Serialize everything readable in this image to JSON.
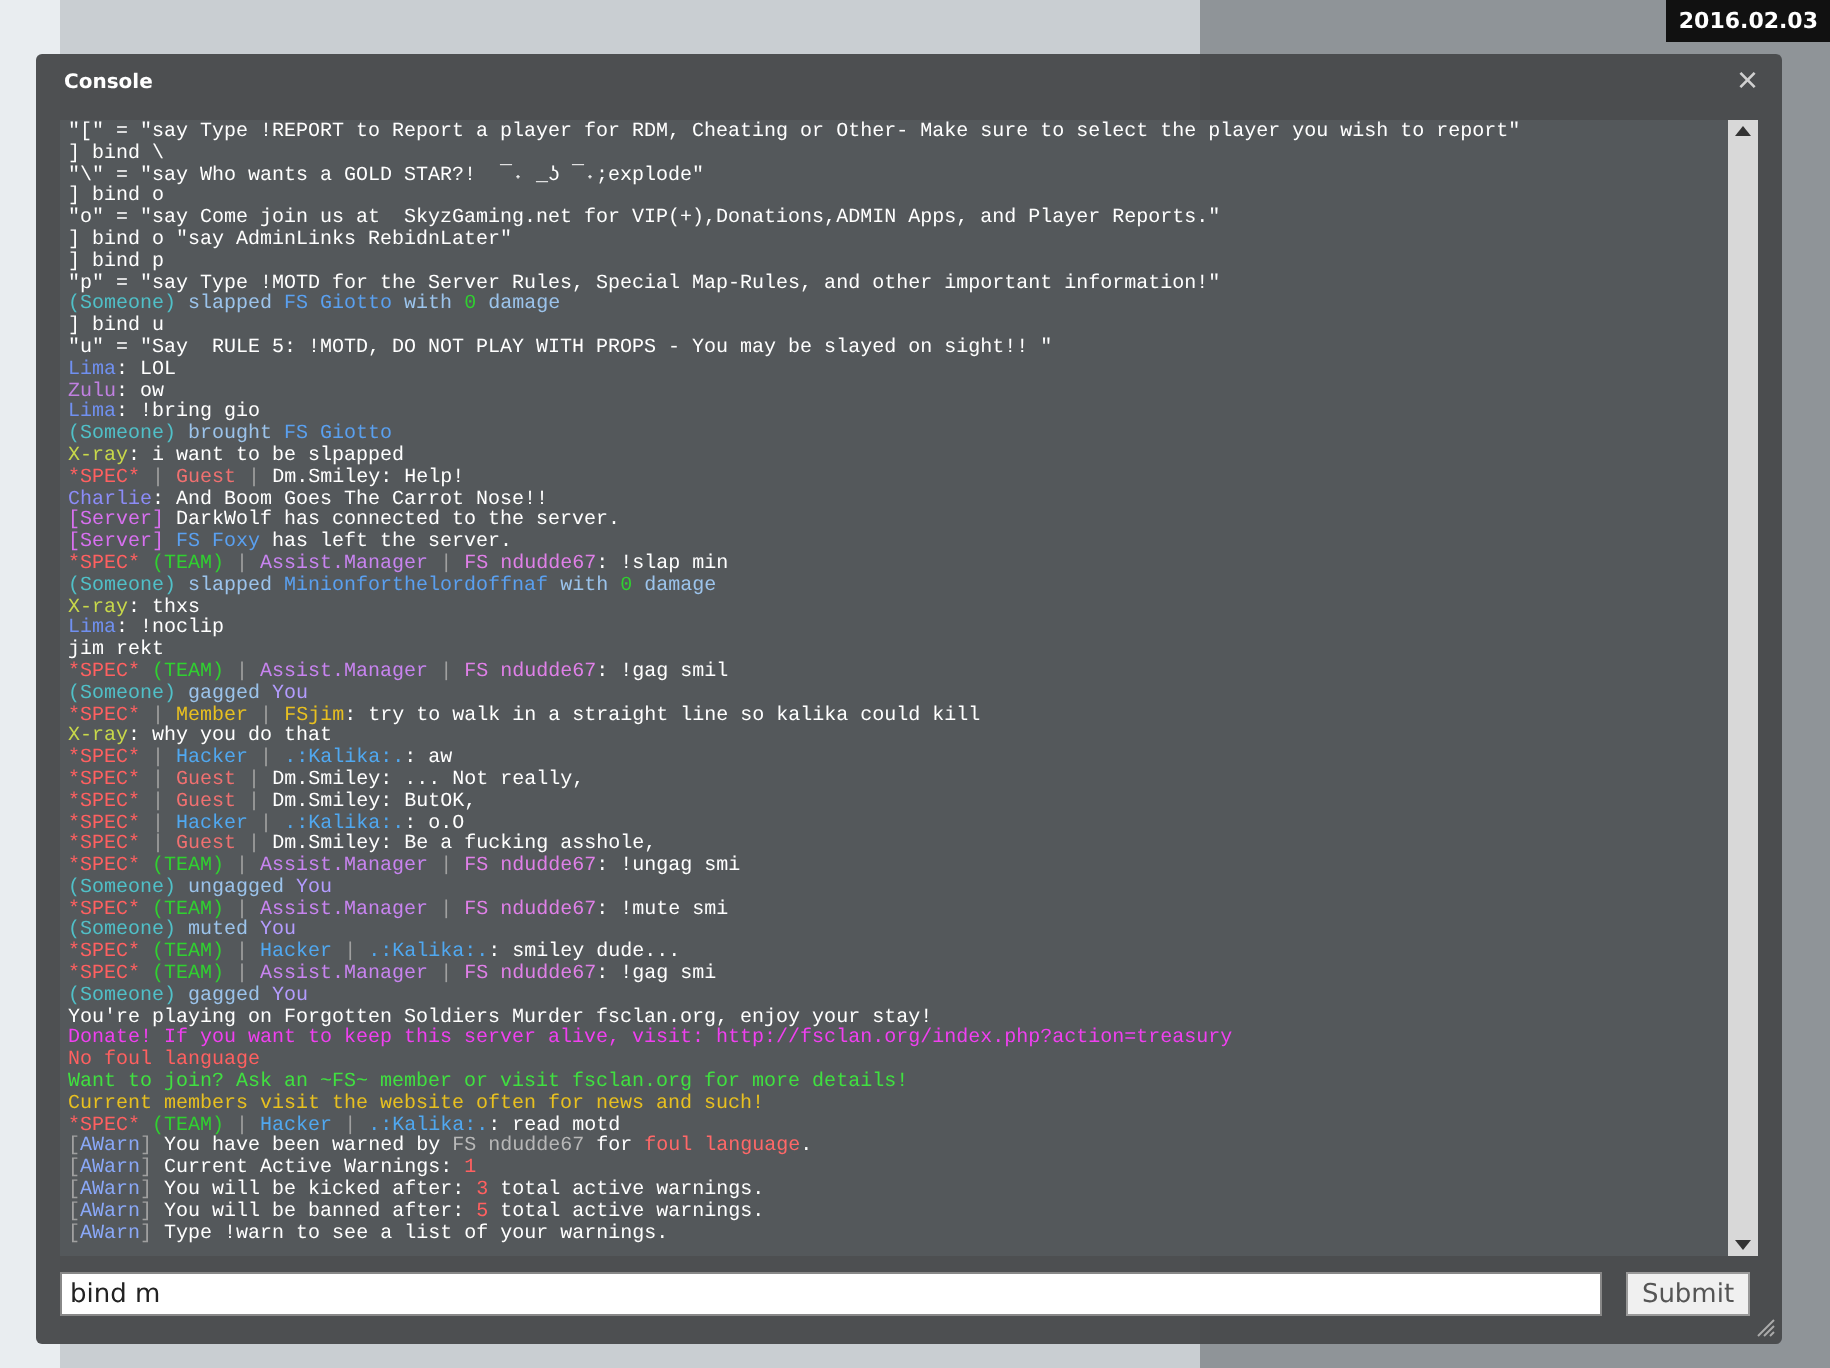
{
  "timestamp": "2016.02.03",
  "window": {
    "title": "Console",
    "close": "×"
  },
  "console": {
    "lines": [
      [
        {
          "text": "\"[\" = \"say Type !REPORT to Report a player for RDM, Cheating or Other- Make sure to select the player you wish to report\"",
          "color": "#ffffff"
        }
      ],
      [
        {
          "text": "] bind \\",
          "color": "#ffffff"
        }
      ],
      [
        {
          "text": "\"\\\" = \"say Who wants a GOLD STAR?!  ¯˖ _ʖ ¯˖;explode\"",
          "color": "#ffffff"
        }
      ],
      [
        {
          "text": "] bind o",
          "color": "#ffffff"
        }
      ],
      [
        {
          "text": "\"o\" = \"say Come join us at  SkyzGaming.net for VIP(+),Donations,ADMIN Apps, and Player Reports.\"",
          "color": "#ffffff"
        }
      ],
      [
        {
          "text": "] bind o \"say AdminLinks RebidnLater\"",
          "color": "#ffffff"
        }
      ],
      [
        {
          "text": "] bind p",
          "color": "#ffffff"
        }
      ],
      [
        {
          "text": "\"p\" = \"say Type !MOTD for the Server Rules, Special Map-Rules, and other important information!\"",
          "color": "#ffffff"
        }
      ],
      [
        {
          "text": "(Someone)",
          "color": "#50c0c8"
        },
        {
          "text": " slapped ",
          "color": "#9cc4ec"
        },
        {
          "text": "FS Giotto",
          "color": "#5aa0f0"
        },
        {
          "text": " with ",
          "color": "#9cc4ec"
        },
        {
          "text": "0",
          "color": "#30d030"
        },
        {
          "text": " damage",
          "color": "#9cc4ec"
        }
      ],
      [
        {
          "text": "] bind u",
          "color": "#ffffff"
        }
      ],
      [
        {
          "text": "\"u\" = \"Say  RULE 5: !MOTD, DO NOT PLAY WITH PROPS - You may be slayed on sight!! \"",
          "color": "#ffffff"
        }
      ],
      [
        {
          "text": "Lima",
          "color": "#7090f0"
        },
        {
          "text": ": LOL",
          "color": "#ffffff"
        }
      ],
      [
        {
          "text": "Zulu",
          "color": "#c080e0"
        },
        {
          "text": ": ow",
          "color": "#ffffff"
        }
      ],
      [
        {
          "text": "Lima",
          "color": "#7090f0"
        },
        {
          "text": ": !bring gio",
          "color": "#ffffff"
        }
      ],
      [
        {
          "text": "(Someone)",
          "color": "#50c0c8"
        },
        {
          "text": " brought ",
          "color": "#9cc4ec"
        },
        {
          "text": "FS Giotto",
          "color": "#5aa0f0"
        }
      ],
      [
        {
          "text": "X-ray",
          "color": "#c8d84a"
        },
        {
          "text": ": i want to be slpapped",
          "color": "#ffffff"
        }
      ],
      [
        {
          "text": "*SPEC*",
          "color": "#ff6060"
        },
        {
          "text": " | ",
          "color": "#a0a0a0"
        },
        {
          "text": "Guest",
          "color": "#f07070"
        },
        {
          "text": " | ",
          "color": "#a0a0a0"
        },
        {
          "text": "Dm.Smiley",
          "color": "#ffffff"
        },
        {
          "text": ": Help!",
          "color": "#ffffff"
        }
      ],
      [
        {
          "text": "Charlie",
          "color": "#8c8cf8"
        },
        {
          "text": ": And Boom Goes The Carrot Nose!!",
          "color": "#ffffff"
        }
      ],
      [
        {
          "text": "[Server]",
          "color": "#d870f0"
        },
        {
          "text": " DarkWolf has connected to the server.",
          "color": "#ffffff"
        }
      ],
      [
        {
          "text": "[Server]",
          "color": "#d870f0"
        },
        {
          "text": " FS Foxy",
          "color": "#5aa0f0"
        },
        {
          "text": " has left the server.",
          "color": "#ffffff"
        }
      ],
      [
        {
          "text": "*SPEC*",
          "color": "#ff6060"
        },
        {
          "text": " (TEAM)",
          "color": "#30d030"
        },
        {
          "text": " | ",
          "color": "#a0a0a0"
        },
        {
          "text": "Assist.Manager",
          "color": "#c884f0"
        },
        {
          "text": " | ",
          "color": "#a0a0a0"
        },
        {
          "text": "FS ndudde67",
          "color": "#e080e8"
        },
        {
          "text": ": !slap min",
          "color": "#ffffff"
        }
      ],
      [
        {
          "text": "(Someone)",
          "color": "#50c0c8"
        },
        {
          "text": " slapped ",
          "color": "#9cc4ec"
        },
        {
          "text": "Minionforthelordoffnaf",
          "color": "#5aa0f0"
        },
        {
          "text": " with ",
          "color": "#9cc4ec"
        },
        {
          "text": "0",
          "color": "#30d030"
        },
        {
          "text": " damage",
          "color": "#9cc4ec"
        }
      ],
      [
        {
          "text": "X-ray",
          "color": "#c8d84a"
        },
        {
          "text": ": thxs",
          "color": "#ffffff"
        }
      ],
      [
        {
          "text": "Lima",
          "color": "#7090f0"
        },
        {
          "text": ": !noclip",
          "color": "#ffffff"
        }
      ],
      [
        {
          "text": "jim rekt",
          "color": "#ffffff"
        }
      ],
      [
        {
          "text": "*SPEC*",
          "color": "#ff6060"
        },
        {
          "text": " (TEAM)",
          "color": "#30d030"
        },
        {
          "text": " | ",
          "color": "#a0a0a0"
        },
        {
          "text": "Assist.Manager",
          "color": "#c884f0"
        },
        {
          "text": " | ",
          "color": "#a0a0a0"
        },
        {
          "text": "FS ndudde67",
          "color": "#e080e8"
        },
        {
          "text": ": !gag smil",
          "color": "#ffffff"
        }
      ],
      [
        {
          "text": "(Someone)",
          "color": "#50c0c8"
        },
        {
          "text": " gagged ",
          "color": "#9cc4ec"
        },
        {
          "text": "You",
          "color": "#b49cff"
        }
      ],
      [
        {
          "text": "*SPEC*",
          "color": "#ff6060"
        },
        {
          "text": " | ",
          "color": "#a0a0a0"
        },
        {
          "text": "Member",
          "color": "#e8c020"
        },
        {
          "text": " | ",
          "color": "#a0a0a0"
        },
        {
          "text": "FSjim",
          "color": "#e8c020"
        },
        {
          "text": ": try to walk in a straight line so kalika could kill",
          "color": "#ffffff"
        }
      ],
      [
        {
          "text": "X-ray",
          "color": "#c8d84a"
        },
        {
          "text": ": why you do that",
          "color": "#ffffff"
        }
      ],
      [
        {
          "text": "*SPEC*",
          "color": "#ff6060"
        },
        {
          "text": " | ",
          "color": "#a0a0a0"
        },
        {
          "text": "Hacker",
          "color": "#50a8f0"
        },
        {
          "text": " | ",
          "color": "#a0a0a0"
        },
        {
          "text": ".:Kalika:.",
          "color": "#50a8f0"
        },
        {
          "text": ": aw",
          "color": "#ffffff"
        }
      ],
      [
        {
          "text": "*SPEC*",
          "color": "#ff6060"
        },
        {
          "text": " | ",
          "color": "#a0a0a0"
        },
        {
          "text": "Guest",
          "color": "#f07070"
        },
        {
          "text": " | ",
          "color": "#a0a0a0"
        },
        {
          "text": "Dm.Smiley",
          "color": "#ffffff"
        },
        {
          "text": ": ... Not really,",
          "color": "#ffffff"
        }
      ],
      [
        {
          "text": "*SPEC*",
          "color": "#ff6060"
        },
        {
          "text": " | ",
          "color": "#a0a0a0"
        },
        {
          "text": "Guest",
          "color": "#f07070"
        },
        {
          "text": " | ",
          "color": "#a0a0a0"
        },
        {
          "text": "Dm.Smiley",
          "color": "#ffffff"
        },
        {
          "text": ": ButOK,",
          "color": "#ffffff"
        }
      ],
      [
        {
          "text": "*SPEC*",
          "color": "#ff6060"
        },
        {
          "text": " | ",
          "color": "#a0a0a0"
        },
        {
          "text": "Hacker",
          "color": "#50a8f0"
        },
        {
          "text": " | ",
          "color": "#a0a0a0"
        },
        {
          "text": ".:Kalika:.",
          "color": "#50a8f0"
        },
        {
          "text": ": o.O",
          "color": "#ffffff"
        }
      ],
      [
        {
          "text": "*SPEC*",
          "color": "#ff6060"
        },
        {
          "text": " | ",
          "color": "#a0a0a0"
        },
        {
          "text": "Guest",
          "color": "#f07070"
        },
        {
          "text": " | ",
          "color": "#a0a0a0"
        },
        {
          "text": "Dm.Smiley",
          "color": "#ffffff"
        },
        {
          "text": ": Be a fucking asshole,",
          "color": "#ffffff"
        }
      ],
      [
        {
          "text": "*SPEC*",
          "color": "#ff6060"
        },
        {
          "text": " (TEAM)",
          "color": "#30d030"
        },
        {
          "text": " | ",
          "color": "#a0a0a0"
        },
        {
          "text": "Assist.Manager",
          "color": "#c884f0"
        },
        {
          "text": " | ",
          "color": "#a0a0a0"
        },
        {
          "text": "FS ndudde67",
          "color": "#e080e8"
        },
        {
          "text": ": !ungag smi",
          "color": "#ffffff"
        }
      ],
      [
        {
          "text": "(Someone)",
          "color": "#50c0c8"
        },
        {
          "text": " ungagged ",
          "color": "#9cc4ec"
        },
        {
          "text": "You",
          "color": "#b49cff"
        }
      ],
      [
        {
          "text": "*SPEC*",
          "color": "#ff6060"
        },
        {
          "text": " (TEAM)",
          "color": "#30d030"
        },
        {
          "text": " | ",
          "color": "#a0a0a0"
        },
        {
          "text": "Assist.Manager",
          "color": "#c884f0"
        },
        {
          "text": " | ",
          "color": "#a0a0a0"
        },
        {
          "text": "FS ndudde67",
          "color": "#e080e8"
        },
        {
          "text": ": !mute smi",
          "color": "#ffffff"
        }
      ],
      [
        {
          "text": "(Someone)",
          "color": "#50c0c8"
        },
        {
          "text": " muted ",
          "color": "#9cc4ec"
        },
        {
          "text": "You",
          "color": "#b49cff"
        }
      ],
      [
        {
          "text": "*SPEC*",
          "color": "#ff6060"
        },
        {
          "text": " (TEAM)",
          "color": "#30d030"
        },
        {
          "text": " | ",
          "color": "#a0a0a0"
        },
        {
          "text": "Hacker",
          "color": "#50a8f0"
        },
        {
          "text": " | ",
          "color": "#a0a0a0"
        },
        {
          "text": ".:Kalika:.",
          "color": "#50a8f0"
        },
        {
          "text": ": smiley dude...",
          "color": "#ffffff"
        }
      ],
      [
        {
          "text": "*SPEC*",
          "color": "#ff6060"
        },
        {
          "text": " (TEAM)",
          "color": "#30d030"
        },
        {
          "text": " | ",
          "color": "#a0a0a0"
        },
        {
          "text": "Assist.Manager",
          "color": "#c884f0"
        },
        {
          "text": " | ",
          "color": "#a0a0a0"
        },
        {
          "text": "FS ndudde67",
          "color": "#e080e8"
        },
        {
          "text": ": !gag smi",
          "color": "#ffffff"
        }
      ],
      [
        {
          "text": "(Someone)",
          "color": "#50c0c8"
        },
        {
          "text": " gagged ",
          "color": "#9cc4ec"
        },
        {
          "text": "You",
          "color": "#b49cff"
        }
      ],
      [
        {
          "text": "You're playing on Forgotten Soldiers Murder fsclan.org, enjoy your stay!",
          "color": "#ffffff"
        }
      ],
      [
        {
          "text": "Donate! If you want to keep this server alive, visit: http://fsclan.org/index.php?action=treasury",
          "color": "#f040f0"
        }
      ],
      [
        {
          "text": "No foul language",
          "color": "#ff6060"
        }
      ],
      [
        {
          "text": "Want to join? Ask an ~FS~ member or visit fsclan.org for more details!",
          "color": "#40e040"
        }
      ],
      [
        {
          "text": "Current members visit the website often for news and such!",
          "color": "#e8c020"
        }
      ],
      [
        {
          "text": "*SPEC*",
          "color": "#ff6060"
        },
        {
          "text": " (TEAM)",
          "color": "#30d030"
        },
        {
          "text": " | ",
          "color": "#a0a0a0"
        },
        {
          "text": "Hacker",
          "color": "#50a8f0"
        },
        {
          "text": " | ",
          "color": "#a0a0a0"
        },
        {
          "text": ".:Kalika:.",
          "color": "#50a8f0"
        },
        {
          "text": ": read motd",
          "color": "#ffffff"
        }
      ],
      [
        {
          "text": "[",
          "color": "#a0a0a0"
        },
        {
          "text": "AWarn",
          "color": "#8aa8f8"
        },
        {
          "text": "] ",
          "color": "#a0a0a0"
        },
        {
          "text": "You have been warned by ",
          "color": "#ffffff"
        },
        {
          "text": "FS ndudde67",
          "color": "#b8b8b8"
        },
        {
          "text": " for ",
          "color": "#ffffff"
        },
        {
          "text": "foul language",
          "color": "#ff6868"
        },
        {
          "text": ".",
          "color": "#ffffff"
        }
      ],
      [
        {
          "text": "[",
          "color": "#a0a0a0"
        },
        {
          "text": "AWarn",
          "color": "#8aa8f8"
        },
        {
          "text": "] ",
          "color": "#a0a0a0"
        },
        {
          "text": "Current Active Warnings: ",
          "color": "#ffffff"
        },
        {
          "text": "1",
          "color": "#ff6060"
        }
      ],
      [
        {
          "text": "[",
          "color": "#a0a0a0"
        },
        {
          "text": "AWarn",
          "color": "#8aa8f8"
        },
        {
          "text": "] ",
          "color": "#a0a0a0"
        },
        {
          "text": "You will be kicked after: ",
          "color": "#ffffff"
        },
        {
          "text": "3",
          "color": "#ff6060"
        },
        {
          "text": " total active warnings.",
          "color": "#ffffff"
        }
      ],
      [
        {
          "text": "[",
          "color": "#a0a0a0"
        },
        {
          "text": "AWarn",
          "color": "#8aa8f8"
        },
        {
          "text": "] ",
          "color": "#a0a0a0"
        },
        {
          "text": "You will be banned after: ",
          "color": "#ffffff"
        },
        {
          "text": "5",
          "color": "#ff6060"
        },
        {
          "text": " total active warnings.",
          "color": "#ffffff"
        }
      ],
      [
        {
          "text": "[",
          "color": "#a0a0a0"
        },
        {
          "text": "AWarn",
          "color": "#8aa8f8"
        },
        {
          "text": "] ",
          "color": "#a0a0a0"
        },
        {
          "text": "Type !warn to see a list of your warnings.",
          "color": "#ffffff"
        }
      ]
    ]
  },
  "input": {
    "value": "bind m"
  },
  "submit": "Submit"
}
